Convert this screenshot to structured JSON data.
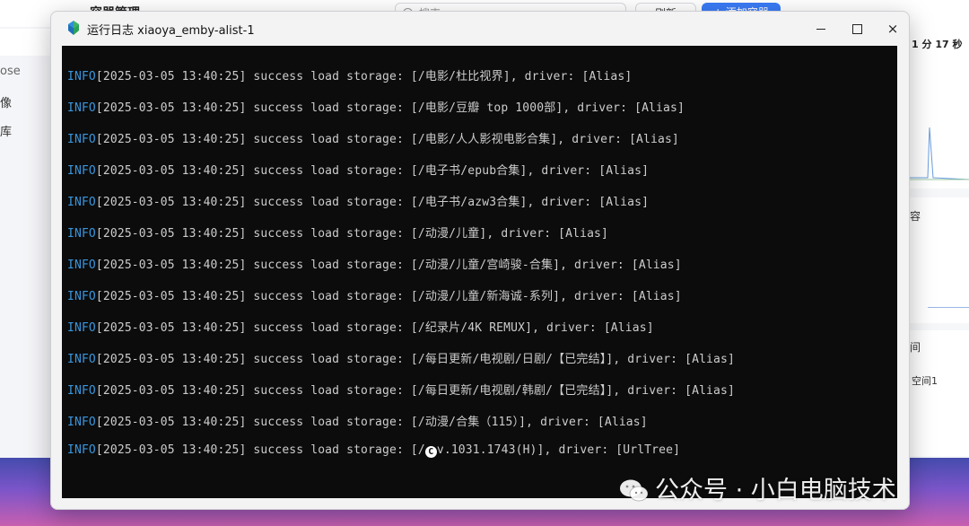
{
  "background_app": {
    "title": "容器管理",
    "search_placeholder": "搜索",
    "button_refresh": "刷新",
    "button_create": "+ 添加容器",
    "sidebar_items": [
      "ose",
      "像",
      "库"
    ],
    "right_time": "1 分 17 秒",
    "right_cut_1": "容",
    "right_cut_2": "间",
    "right_space": "空间1"
  },
  "window": {
    "title": "运行日志 xiaoya_emby-alist-1",
    "icon": "app-logo-icon",
    "controls": {
      "minimize": "minimize-icon",
      "maximize": "maximize-icon",
      "close": "×"
    }
  },
  "log": {
    "lines": [
      {
        "level": "INFO",
        "text": "[2025-03-05 13:40:25] success load storage: [/电影/杜比视界], driver: [Alias]"
      },
      {
        "level": "INFO",
        "text": "[2025-03-05 13:40:25] success load storage: [/电影/豆瓣 top 1000部], driver: [Alias]"
      },
      {
        "level": "INFO",
        "text": "[2025-03-05 13:40:25] success load storage: [/电影/人人影视电影合集], driver: [Alias]"
      },
      {
        "level": "INFO",
        "text": "[2025-03-05 13:40:25] success load storage: [/电子书/epub合集], driver: [Alias]"
      },
      {
        "level": "INFO",
        "text": "[2025-03-05 13:40:25] success load storage: [/电子书/azw3合集], driver: [Alias]"
      },
      {
        "level": "INFO",
        "text": "[2025-03-05 13:40:25] success load storage: [/动漫/儿童], driver: [Alias]"
      },
      {
        "level": "INFO",
        "text": "[2025-03-05 13:40:25] success load storage: [/动漫/儿童/宫崎骏-合集], driver: [Alias]"
      },
      {
        "level": "INFO",
        "text": "[2025-03-05 13:40:25] success load storage: [/动漫/儿童/新海诚-系列], driver: [Alias]"
      },
      {
        "level": "INFO",
        "text": "[2025-03-05 13:40:25] success load storage: [/纪录片/4K REMUX], driver: [Alias]"
      },
      {
        "level": "INFO",
        "text": "[2025-03-05 13:40:25] success load storage: [/每日更新/电视剧/日剧/【已完结】], driver: [Alias]"
      },
      {
        "level": "INFO",
        "text": "[2025-03-05 13:40:25] success load storage: [/每日更新/电视剧/韩剧/【已完结】], driver: [Alias]"
      },
      {
        "level": "INFO",
        "text": "[2025-03-05 13:40:25] success load storage: [/动漫/合集（115）], driver: [Alias]"
      }
    ],
    "last_line": {
      "level": "INFO",
      "prefix": "[2025-03-05 13:40:25] success load storage: [/",
      "badge": "C",
      "suffix": "v.1031.1743(H)], driver: [UrlTree]"
    },
    "colors": {
      "background": "#0c0c0c",
      "text": "#cccccc",
      "level": "#3a96dd"
    }
  },
  "watermark": {
    "text": "公众号 · 小白电脑技术",
    "icon": "wechat-icon"
  }
}
